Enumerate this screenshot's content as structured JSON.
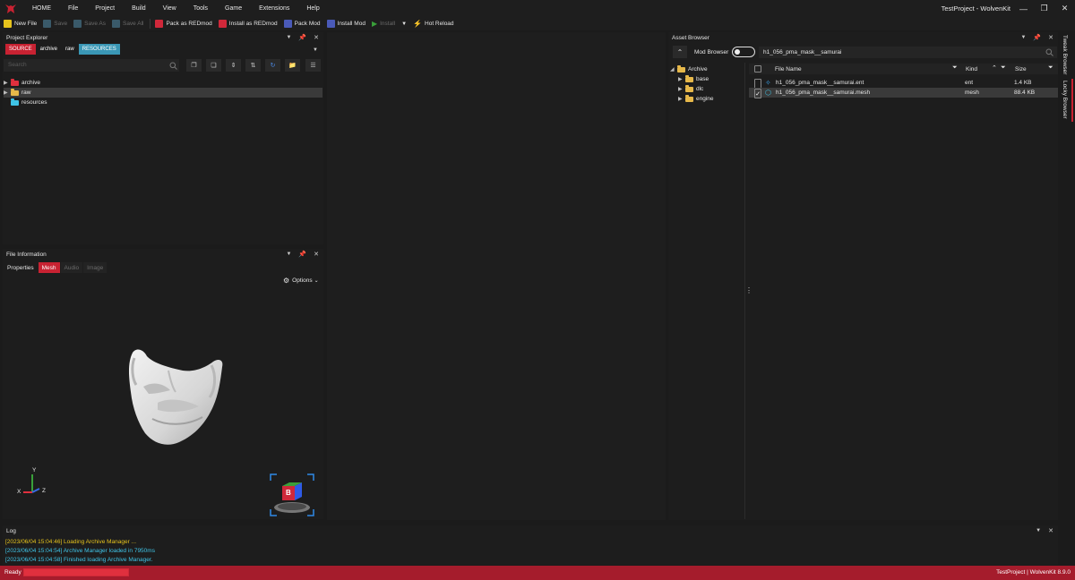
{
  "menubar": {
    "items": [
      "HOME",
      "File",
      "Project",
      "Build",
      "View",
      "Tools",
      "Game",
      "Extensions",
      "Help"
    ],
    "window_title": "TestProject - WolvenKit"
  },
  "toolbar": {
    "new_file": "New File",
    "save": "Save",
    "save_as": "Save As",
    "save_all": "Save All",
    "pack_redmod": "Pack as REDmod",
    "install_redmod": "Install as REDmod",
    "pack_mod": "Pack Mod",
    "install_mod": "Install Mod",
    "install": "Install",
    "hot_reload": "Hot Reload"
  },
  "project_explorer": {
    "title": "Project Explorer",
    "tabs": [
      "SOURCE",
      "archive",
      "raw",
      "RESOURCES"
    ],
    "search_placeholder": "Search",
    "tree": [
      {
        "label": "archive",
        "has_children": true,
        "folder_color": "#e0303e"
      },
      {
        "label": "raw",
        "has_children": true,
        "folder_color": "#e6b84a"
      },
      {
        "label": "resources",
        "has_children": false,
        "folder_color": "#3fc3e6"
      }
    ]
  },
  "file_information": {
    "title": "File Information",
    "tabs": [
      "Properties",
      "Mesh",
      "Audio",
      "Image"
    ],
    "active_tab": "Mesh",
    "options_label": "Options",
    "axis_labels": {
      "x": "X",
      "y": "Y",
      "z": "Z"
    },
    "gizmo_label": "B"
  },
  "asset_browser": {
    "title": "Asset Browser",
    "mod_browser_label": "Mod Browser",
    "search_value": "h1_056_pma_mask__samurai",
    "tree_root": "Archive",
    "tree_children": [
      "base",
      "dlc",
      "engine"
    ],
    "columns": {
      "name": "File Name",
      "kind": "Kind",
      "size": "Size"
    },
    "rows": [
      {
        "name": "h1_056_pma_mask__samurai.ent",
        "kind": "ent",
        "size": "1.4 KB",
        "checked": false,
        "selected": false
      },
      {
        "name": "h1_056_pma_mask__samurai.mesh",
        "kind": "mesh",
        "size": "88.4 KB",
        "checked": true,
        "selected": true
      }
    ]
  },
  "side_tabs": [
    "Tweak Browser",
    "Locky Browser"
  ],
  "log": {
    "title": "Log",
    "lines": [
      {
        "text": "[2023/06/04 15:04:46] Loading Archive Manager ...",
        "color": "#e6c31c"
      },
      {
        "text": "[2023/06/04 15:04:54] Archive Manager loaded in 7950ms",
        "color": "#3fc3e6"
      },
      {
        "text": "[2023/06/04 15:04:58] Finished loading Archive Manager.",
        "color": "#3fc3e6"
      }
    ]
  },
  "status": {
    "left": "Ready",
    "right": "TestProject | WolvenKit 8.9.0"
  },
  "colors": {
    "accent_red": "#c82232",
    "resources_tab": "#3a97b5",
    "status_bar": "#a51c2c"
  }
}
